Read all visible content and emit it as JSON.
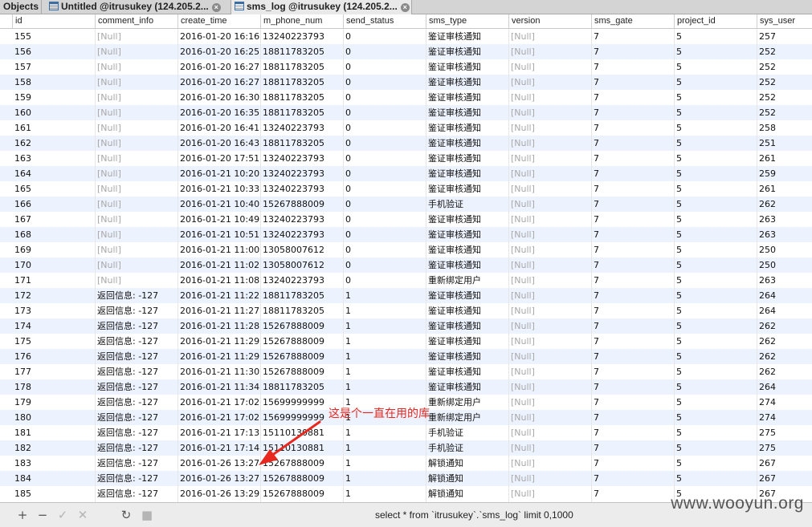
{
  "tabs": [
    {
      "label": "Objects",
      "active": false,
      "icon": "",
      "closable": false
    },
    {
      "label": "Untitled @itrusukey (124.205.2...",
      "active": false,
      "icon": "query-icon",
      "closable": true
    },
    {
      "label": "sms_log @itrusukey (124.205.2...",
      "active": true,
      "icon": "table-icon",
      "closable": true
    }
  ],
  "columns": [
    "id",
    "comment_info",
    "create_time",
    "m_phone_num",
    "send_status",
    "sms_type",
    "version",
    "sms_gate",
    "project_id",
    "sys_user"
  ],
  "rows": [
    [
      "155",
      "[Null]",
      "2016-01-20 16:16:",
      "13240223793",
      "0",
      "鉴证审核通知",
      "[Null]",
      "7",
      "5",
      "257"
    ],
    [
      "156",
      "[Null]",
      "2016-01-20 16:25:",
      "18811783205",
      "0",
      "鉴证审核通知",
      "[Null]",
      "7",
      "5",
      "252"
    ],
    [
      "157",
      "[Null]",
      "2016-01-20 16:27:",
      "18811783205",
      "0",
      "鉴证审核通知",
      "[Null]",
      "7",
      "5",
      "252"
    ],
    [
      "158",
      "[Null]",
      "2016-01-20 16:27:",
      "18811783205",
      "0",
      "鉴证审核通知",
      "[Null]",
      "7",
      "5",
      "252"
    ],
    [
      "159",
      "[Null]",
      "2016-01-20 16:30:",
      "18811783205",
      "0",
      "鉴证审核通知",
      "[Null]",
      "7",
      "5",
      "252"
    ],
    [
      "160",
      "[Null]",
      "2016-01-20 16:35:",
      "18811783205",
      "0",
      "鉴证审核通知",
      "[Null]",
      "7",
      "5",
      "252"
    ],
    [
      "161",
      "[Null]",
      "2016-01-20 16:41:",
      "13240223793",
      "0",
      "鉴证审核通知",
      "[Null]",
      "7",
      "5",
      "258"
    ],
    [
      "162",
      "[Null]",
      "2016-01-20 16:43:",
      "18811783205",
      "0",
      "鉴证审核通知",
      "[Null]",
      "7",
      "5",
      "251"
    ],
    [
      "163",
      "[Null]",
      "2016-01-20 17:51:",
      "13240223793",
      "0",
      "鉴证审核通知",
      "[Null]",
      "7",
      "5",
      "261"
    ],
    [
      "164",
      "[Null]",
      "2016-01-21 10:20:",
      "13240223793",
      "0",
      "鉴证审核通知",
      "[Null]",
      "7",
      "5",
      "259"
    ],
    [
      "165",
      "[Null]",
      "2016-01-21 10:33:",
      "13240223793",
      "0",
      "鉴证审核通知",
      "[Null]",
      "7",
      "5",
      "261"
    ],
    [
      "166",
      "[Null]",
      "2016-01-21 10:40:",
      "15267888009",
      "0",
      "手机验证",
      "[Null]",
      "7",
      "5",
      "262"
    ],
    [
      "167",
      "[Null]",
      "2016-01-21 10:49:",
      "13240223793",
      "0",
      "鉴证审核通知",
      "[Null]",
      "7",
      "5",
      "263"
    ],
    [
      "168",
      "[Null]",
      "2016-01-21 10:51:",
      "13240223793",
      "0",
      "鉴证审核通知",
      "[Null]",
      "7",
      "5",
      "263"
    ],
    [
      "169",
      "[Null]",
      "2016-01-21 11:00:",
      "13058007612",
      "0",
      "鉴证审核通知",
      "[Null]",
      "7",
      "5",
      "250"
    ],
    [
      "170",
      "[Null]",
      "2016-01-21 11:02:",
      "13058007612",
      "0",
      "鉴证审核通知",
      "[Null]",
      "7",
      "5",
      "250"
    ],
    [
      "171",
      "[Null]",
      "2016-01-21 11:08:",
      "13240223793",
      "0",
      "重新绑定用户",
      "[Null]",
      "7",
      "5",
      "263"
    ],
    [
      "172",
      "返回信息: -127",
      "2016-01-21 11:22:",
      "18811783205",
      "1",
      "鉴证审核通知",
      "[Null]",
      "7",
      "5",
      "264"
    ],
    [
      "173",
      "返回信息: -127",
      "2016-01-21 11:27:",
      "18811783205",
      "1",
      "鉴证审核通知",
      "[Null]",
      "7",
      "5",
      "264"
    ],
    [
      "174",
      "返回信息: -127",
      "2016-01-21 11:28:",
      "15267888009",
      "1",
      "鉴证审核通知",
      "[Null]",
      "7",
      "5",
      "262"
    ],
    [
      "175",
      "返回信息: -127",
      "2016-01-21 11:29:",
      "15267888009",
      "1",
      "鉴证审核通知",
      "[Null]",
      "7",
      "5",
      "262"
    ],
    [
      "176",
      "返回信息: -127",
      "2016-01-21 11:29:",
      "15267888009",
      "1",
      "鉴证审核通知",
      "[Null]",
      "7",
      "5",
      "262"
    ],
    [
      "177",
      "返回信息: -127",
      "2016-01-21 11:30:",
      "15267888009",
      "1",
      "鉴证审核通知",
      "[Null]",
      "7",
      "5",
      "262"
    ],
    [
      "178",
      "返回信息: -127",
      "2016-01-21 11:34:",
      "18811783205",
      "1",
      "鉴证审核通知",
      "[Null]",
      "7",
      "5",
      "264"
    ],
    [
      "179",
      "返回信息: -127",
      "2016-01-21 17:02:",
      "15699999999",
      "1",
      "重新绑定用户",
      "[Null]",
      "7",
      "5",
      "274"
    ],
    [
      "180",
      "返回信息: -127",
      "2016-01-21 17:02:",
      "15699999999",
      "1",
      "重新绑定用户",
      "[Null]",
      "7",
      "5",
      "274"
    ],
    [
      "181",
      "返回信息: -127",
      "2016-01-21 17:13:",
      "15110130881",
      "1",
      "手机验证",
      "[Null]",
      "7",
      "5",
      "275"
    ],
    [
      "182",
      "返回信息: -127",
      "2016-01-21 17:14:",
      "15110130881",
      "1",
      "手机验证",
      "[Null]",
      "7",
      "5",
      "275"
    ],
    [
      "183",
      "返回信息: -127",
      "2016-01-26 13:27:",
      "15267888009",
      "1",
      "解锁通知",
      "[Null]",
      "7",
      "5",
      "267"
    ],
    [
      "184",
      "返回信息: -127",
      "2016-01-26 13:27:",
      "15267888009",
      "1",
      "解锁通知",
      "[Null]",
      "7",
      "5",
      "267"
    ],
    [
      "185",
      "返回信息: -127",
      "2016-01-26 13:29:",
      "15267888009",
      "1",
      "解锁通知",
      "[Null]",
      "7",
      "5",
      "267"
    ]
  ],
  "annotation": {
    "text": "这是个一直在用的库",
    "color": "#e8281f"
  },
  "toolbar": {
    "buttons": [
      {
        "name": "add-record-button",
        "glyph": "+",
        "enabled": true
      },
      {
        "name": "delete-record-button",
        "glyph": "−",
        "enabled": true
      },
      {
        "name": "apply-changes-button",
        "glyph": "✓",
        "enabled": false
      },
      {
        "name": "discard-changes-button",
        "glyph": "✕",
        "enabled": false
      },
      {
        "name": "refresh-button",
        "glyph": "↻",
        "enabled": true
      },
      {
        "name": "stop-button",
        "glyph": "■",
        "enabled": false
      }
    ],
    "sql": "select * from `itrusukey`.`sms_log`  limit 0,1000"
  },
  "watermark": "www.wooyun.org"
}
